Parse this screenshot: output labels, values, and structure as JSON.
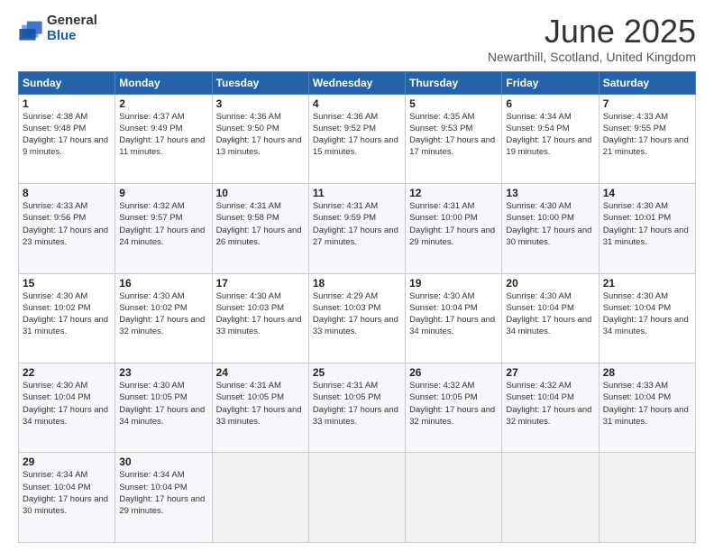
{
  "logo": {
    "general": "General",
    "blue": "Blue"
  },
  "header": {
    "month": "June 2025",
    "location": "Newarthill, Scotland, United Kingdom"
  },
  "days_of_week": [
    "Sunday",
    "Monday",
    "Tuesday",
    "Wednesday",
    "Thursday",
    "Friday",
    "Saturday"
  ],
  "weeks": [
    [
      {
        "day": "1",
        "sunrise": "4:38 AM",
        "sunset": "9:48 PM",
        "daylight": "17 hours and 9 minutes."
      },
      {
        "day": "2",
        "sunrise": "4:37 AM",
        "sunset": "9:49 PM",
        "daylight": "17 hours and 11 minutes."
      },
      {
        "day": "3",
        "sunrise": "4:36 AM",
        "sunset": "9:50 PM",
        "daylight": "17 hours and 13 minutes."
      },
      {
        "day": "4",
        "sunrise": "4:36 AM",
        "sunset": "9:52 PM",
        "daylight": "17 hours and 15 minutes."
      },
      {
        "day": "5",
        "sunrise": "4:35 AM",
        "sunset": "9:53 PM",
        "daylight": "17 hours and 17 minutes."
      },
      {
        "day": "6",
        "sunrise": "4:34 AM",
        "sunset": "9:54 PM",
        "daylight": "17 hours and 19 minutes."
      },
      {
        "day": "7",
        "sunrise": "4:33 AM",
        "sunset": "9:55 PM",
        "daylight": "17 hours and 21 minutes."
      }
    ],
    [
      {
        "day": "8",
        "sunrise": "4:33 AM",
        "sunset": "9:56 PM",
        "daylight": "17 hours and 23 minutes."
      },
      {
        "day": "9",
        "sunrise": "4:32 AM",
        "sunset": "9:57 PM",
        "daylight": "17 hours and 24 minutes."
      },
      {
        "day": "10",
        "sunrise": "4:31 AM",
        "sunset": "9:58 PM",
        "daylight": "17 hours and 26 minutes."
      },
      {
        "day": "11",
        "sunrise": "4:31 AM",
        "sunset": "9:59 PM",
        "daylight": "17 hours and 27 minutes."
      },
      {
        "day": "12",
        "sunrise": "4:31 AM",
        "sunset": "10:00 PM",
        "daylight": "17 hours and 29 minutes."
      },
      {
        "day": "13",
        "sunrise": "4:30 AM",
        "sunset": "10:00 PM",
        "daylight": "17 hours and 30 minutes."
      },
      {
        "day": "14",
        "sunrise": "4:30 AM",
        "sunset": "10:01 PM",
        "daylight": "17 hours and 31 minutes."
      }
    ],
    [
      {
        "day": "15",
        "sunrise": "4:30 AM",
        "sunset": "10:02 PM",
        "daylight": "17 hours and 31 minutes."
      },
      {
        "day": "16",
        "sunrise": "4:30 AM",
        "sunset": "10:02 PM",
        "daylight": "17 hours and 32 minutes."
      },
      {
        "day": "17",
        "sunrise": "4:30 AM",
        "sunset": "10:03 PM",
        "daylight": "17 hours and 33 minutes."
      },
      {
        "day": "18",
        "sunrise": "4:29 AM",
        "sunset": "10:03 PM",
        "daylight": "17 hours and 33 minutes."
      },
      {
        "day": "19",
        "sunrise": "4:30 AM",
        "sunset": "10:04 PM",
        "daylight": "17 hours and 34 minutes."
      },
      {
        "day": "20",
        "sunrise": "4:30 AM",
        "sunset": "10:04 PM",
        "daylight": "17 hours and 34 minutes."
      },
      {
        "day": "21",
        "sunrise": "4:30 AM",
        "sunset": "10:04 PM",
        "daylight": "17 hours and 34 minutes."
      }
    ],
    [
      {
        "day": "22",
        "sunrise": "4:30 AM",
        "sunset": "10:04 PM",
        "daylight": "17 hours and 34 minutes."
      },
      {
        "day": "23",
        "sunrise": "4:30 AM",
        "sunset": "10:05 PM",
        "daylight": "17 hours and 34 minutes."
      },
      {
        "day": "24",
        "sunrise": "4:31 AM",
        "sunset": "10:05 PM",
        "daylight": "17 hours and 33 minutes."
      },
      {
        "day": "25",
        "sunrise": "4:31 AM",
        "sunset": "10:05 PM",
        "daylight": "17 hours and 33 minutes."
      },
      {
        "day": "26",
        "sunrise": "4:32 AM",
        "sunset": "10:05 PM",
        "daylight": "17 hours and 32 minutes."
      },
      {
        "day": "27",
        "sunrise": "4:32 AM",
        "sunset": "10:04 PM",
        "daylight": "17 hours and 32 minutes."
      },
      {
        "day": "28",
        "sunrise": "4:33 AM",
        "sunset": "10:04 PM",
        "daylight": "17 hours and 31 minutes."
      }
    ],
    [
      {
        "day": "29",
        "sunrise": "4:34 AM",
        "sunset": "10:04 PM",
        "daylight": "17 hours and 30 minutes."
      },
      {
        "day": "30",
        "sunrise": "4:34 AM",
        "sunset": "10:04 PM",
        "daylight": "17 hours and 29 minutes."
      },
      null,
      null,
      null,
      null,
      null
    ]
  ]
}
